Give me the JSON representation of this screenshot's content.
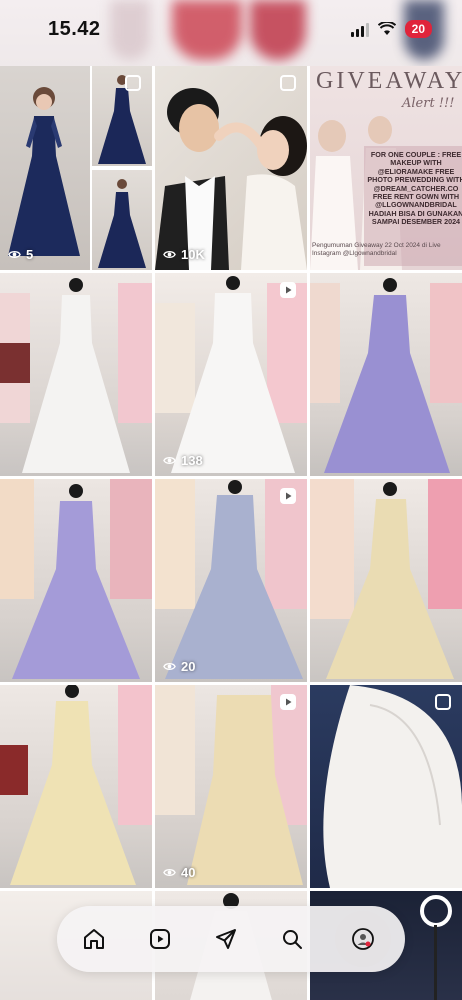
{
  "status_bar": {
    "time": "15.42",
    "battery": "20"
  },
  "posts": [
    {
      "id": "collage-navy-gowns",
      "views": "5",
      "badge": "multi-icon"
    },
    {
      "id": "couple-photo",
      "views": "10K",
      "badge": "multi-icon"
    },
    {
      "id": "giveaway-poster",
      "views": "",
      "badge": ""
    },
    {
      "id": "white-gown-1",
      "views": "",
      "badge": ""
    },
    {
      "id": "white-gown-2",
      "views": "138",
      "badge": "reels-icon"
    },
    {
      "id": "lavender-gown-back",
      "views": "",
      "badge": ""
    },
    {
      "id": "lavender-gown-front",
      "views": "",
      "badge": ""
    },
    {
      "id": "blue-ruffle-gown",
      "views": "20",
      "badge": "reels-icon"
    },
    {
      "id": "champagne-gown-back",
      "views": "",
      "badge": ""
    },
    {
      "id": "cream-gown-1",
      "views": "",
      "badge": ""
    },
    {
      "id": "cream-gown-2",
      "views": "40",
      "badge": "reels-icon"
    },
    {
      "id": "veil-photo",
      "views": "",
      "badge": "multi-icon"
    }
  ],
  "giveaway": {
    "title": "GIVEAWAY",
    "alert": "Alert !!!",
    "body": "FOR ONE COUPLE : FREE MAKEUP WITH @ELIORAMAKE FREE PHOTO PREWEDDING WITH @DREAM_CATCHER.CO FREE RENT GOWN WITH @LLGOWNANDBRIDAL HADIAH BISA DI GUNAKAN SAMPAI DESEMBER 2024",
    "foot": "Pengumuman Giveaway 22 Oct 2024 di Live Instagram @Llgownandbridal"
  },
  "nav": {
    "items": [
      {
        "name": "home-icon"
      },
      {
        "name": "reels-icon"
      },
      {
        "name": "send-icon"
      },
      {
        "name": "search-icon"
      },
      {
        "name": "profile-icon"
      }
    ]
  }
}
